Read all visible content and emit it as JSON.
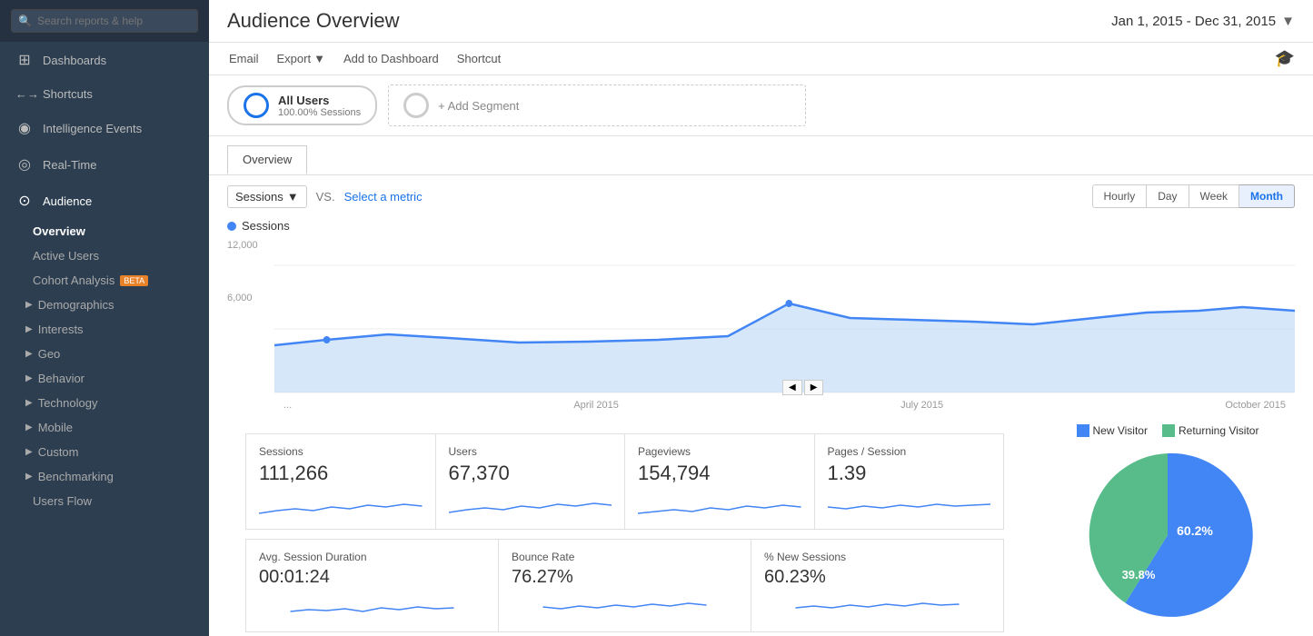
{
  "sidebar": {
    "search_placeholder": "Search reports & help",
    "nav_items": [
      {
        "id": "dashboards",
        "label": "Dashboards",
        "icon": "⊞"
      },
      {
        "id": "shortcuts",
        "label": "Shortcuts",
        "icon": "←→"
      },
      {
        "id": "intelligence",
        "label": "Intelligence Events",
        "icon": "◉"
      },
      {
        "id": "realtime",
        "label": "Real-Time",
        "icon": "◎"
      },
      {
        "id": "audience",
        "label": "Audience",
        "icon": "⊙"
      }
    ],
    "audience_sub": [
      {
        "id": "overview",
        "label": "Overview",
        "indent": false
      },
      {
        "id": "active-users",
        "label": "Active Users",
        "indent": false
      },
      {
        "id": "cohort",
        "label": "Cohort Analysis",
        "badge": "BETA",
        "indent": false
      },
      {
        "id": "demographics",
        "label": "Demographics",
        "collapsible": true
      },
      {
        "id": "interests",
        "label": "Interests",
        "collapsible": true
      },
      {
        "id": "geo",
        "label": "Geo",
        "collapsible": true
      },
      {
        "id": "behavior",
        "label": "Behavior",
        "collapsible": true
      },
      {
        "id": "technology",
        "label": "Technology",
        "collapsible": true
      },
      {
        "id": "mobile",
        "label": "Mobile",
        "collapsible": true
      },
      {
        "id": "custom",
        "label": "Custom",
        "collapsible": true
      },
      {
        "id": "benchmarking",
        "label": "Benchmarking",
        "collapsible": true
      },
      {
        "id": "users-flow",
        "label": "Users Flow",
        "indent": false
      }
    ]
  },
  "header": {
    "title": "Audience Overview",
    "date_range": "Jan 1, 2015 - Dec 31, 2015"
  },
  "toolbar": {
    "email": "Email",
    "export": "Export",
    "add_to_dashboard": "Add to Dashboard",
    "shortcut": "Shortcut"
  },
  "segments": {
    "all_users": "All Users",
    "all_users_sub": "100.00% Sessions",
    "add_segment": "+ Add Segment"
  },
  "overview_tab": "Overview",
  "chart": {
    "metric": "Sessions",
    "vs_label": "VS.",
    "select_metric": "Select a metric",
    "time_buttons": [
      "Hourly",
      "Day",
      "Week",
      "Month"
    ],
    "active_time": "Month",
    "y_labels": [
      "12,000",
      "6,000",
      ""
    ],
    "x_labels": [
      "...",
      "April 2015",
      "July 2015",
      "October 2015"
    ],
    "legend": "Sessions",
    "legend_color": "#4285f4"
  },
  "stats": [
    {
      "label": "Sessions",
      "value": "111,266"
    },
    {
      "label": "Users",
      "value": "67,370"
    },
    {
      "label": "Pageviews",
      "value": "154,794"
    },
    {
      "label": "Pages / Session",
      "value": "1.39"
    }
  ],
  "stats2": [
    {
      "label": "Avg. Session Duration",
      "value": "00:01:24"
    },
    {
      "label": "Bounce Rate",
      "value": "76.27%"
    },
    {
      "label": "% New Sessions",
      "value": "60.23%"
    }
  ],
  "pie": {
    "legend": [
      {
        "label": "New Visitor",
        "color": "#4285f4"
      },
      {
        "label": "Returning Visitor",
        "color": "#57bb8a"
      }
    ],
    "new_pct": "60.2%",
    "returning_pct": "39.8%",
    "new_value": 60.2,
    "returning_value": 39.8
  }
}
